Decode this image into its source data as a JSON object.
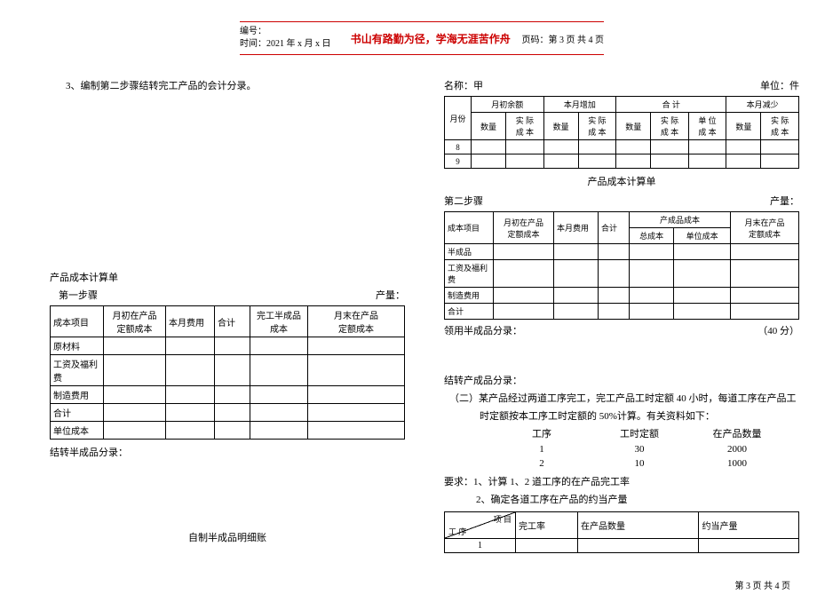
{
  "header": {
    "left_line1": "编号：",
    "left_line2": "时间：2021 年 x 月 x 日",
    "center": "书山有路勤为径，学海无涯苦作舟",
    "right": "页码：第 3 页 共 4 页"
  },
  "q3": "3、编制第二步骤结转完工产品的会计分录。",
  "left": {
    "cost_sheet_title": "产品成本计算单",
    "step1_row": {
      "label": "第一步骤",
      "qty": "产量："
    },
    "t1_headers": {
      "c0": "成本项目",
      "c1": "月初在产品\n定额成本",
      "c2": "本月费用",
      "c3": "合计",
      "c4": "完工半成品\n成本",
      "c5": "月末在产品\n定额成本"
    },
    "t1_rows": [
      "原材料",
      "工资及福利费",
      "制造费用",
      "合计",
      "单位成本"
    ],
    "transfer_semi": "结转半成品分录：",
    "self_made_ledger": "自制半成品明细账"
  },
  "right_top": {
    "name_row": {
      "l": "名称：甲",
      "r": "单位：件"
    },
    "h1": {
      "month": "月份",
      "beg": "月初余额",
      "inc": "本月增加",
      "total": "合 计",
      "dec": "本月减少",
      "qty": "数量",
      "cost": "实 际\n成 本",
      "unit": "单 位\n成 本"
    },
    "rows": [
      "8",
      "9"
    ],
    "cost_sheet_title": "产品成本计算单",
    "step2_row": {
      "label": "第二步骤",
      "qty": "产量："
    },
    "t2_headers": {
      "c0": "成本项目",
      "c1": "月初在产品\n定额成本",
      "c2": "本月费用",
      "c3": "合计",
      "c4a": "产成品成本",
      "c4b1": "总成本",
      "c4b2": "单位成本",
      "c5": "月末在产品\n定额成本"
    },
    "t2_rows": [
      "半成品",
      "工资及福利费",
      "制造费用",
      "合计"
    ],
    "receive_entry_row": {
      "l": "领用半成品分录：",
      "r": "（40 分）"
    }
  },
  "right_bottom": {
    "transfer_fg": "结转产成品分录：",
    "p2_line1": "（二）某产品经过两道工序完工，完工产品工时定额 40 小时，每道工序在产品工",
    "p2_line2": "时定额按本工序工时定额的 50%计算。有关资料如下：",
    "col_headers": {
      "a": "工序",
      "b": "工时定额",
      "c": "在产品数量"
    },
    "rows": [
      {
        "a": "1",
        "b": "30",
        "c": "2000"
      },
      {
        "a": "2",
        "b": "10",
        "c": "1000"
      }
    ],
    "req_label": "要求：",
    "req1": "1、计算 1、2 道工序的在产品完工率",
    "req2": "2、确定各道工序在产品的约当产量",
    "t3": {
      "diag_top": "项 目",
      "diag_bot": "工 序",
      "c1": "完工率",
      "c2": "在产品数量",
      "c3": "约当产量",
      "row": "1"
    }
  },
  "footer": "第 3 页 共 4 页"
}
